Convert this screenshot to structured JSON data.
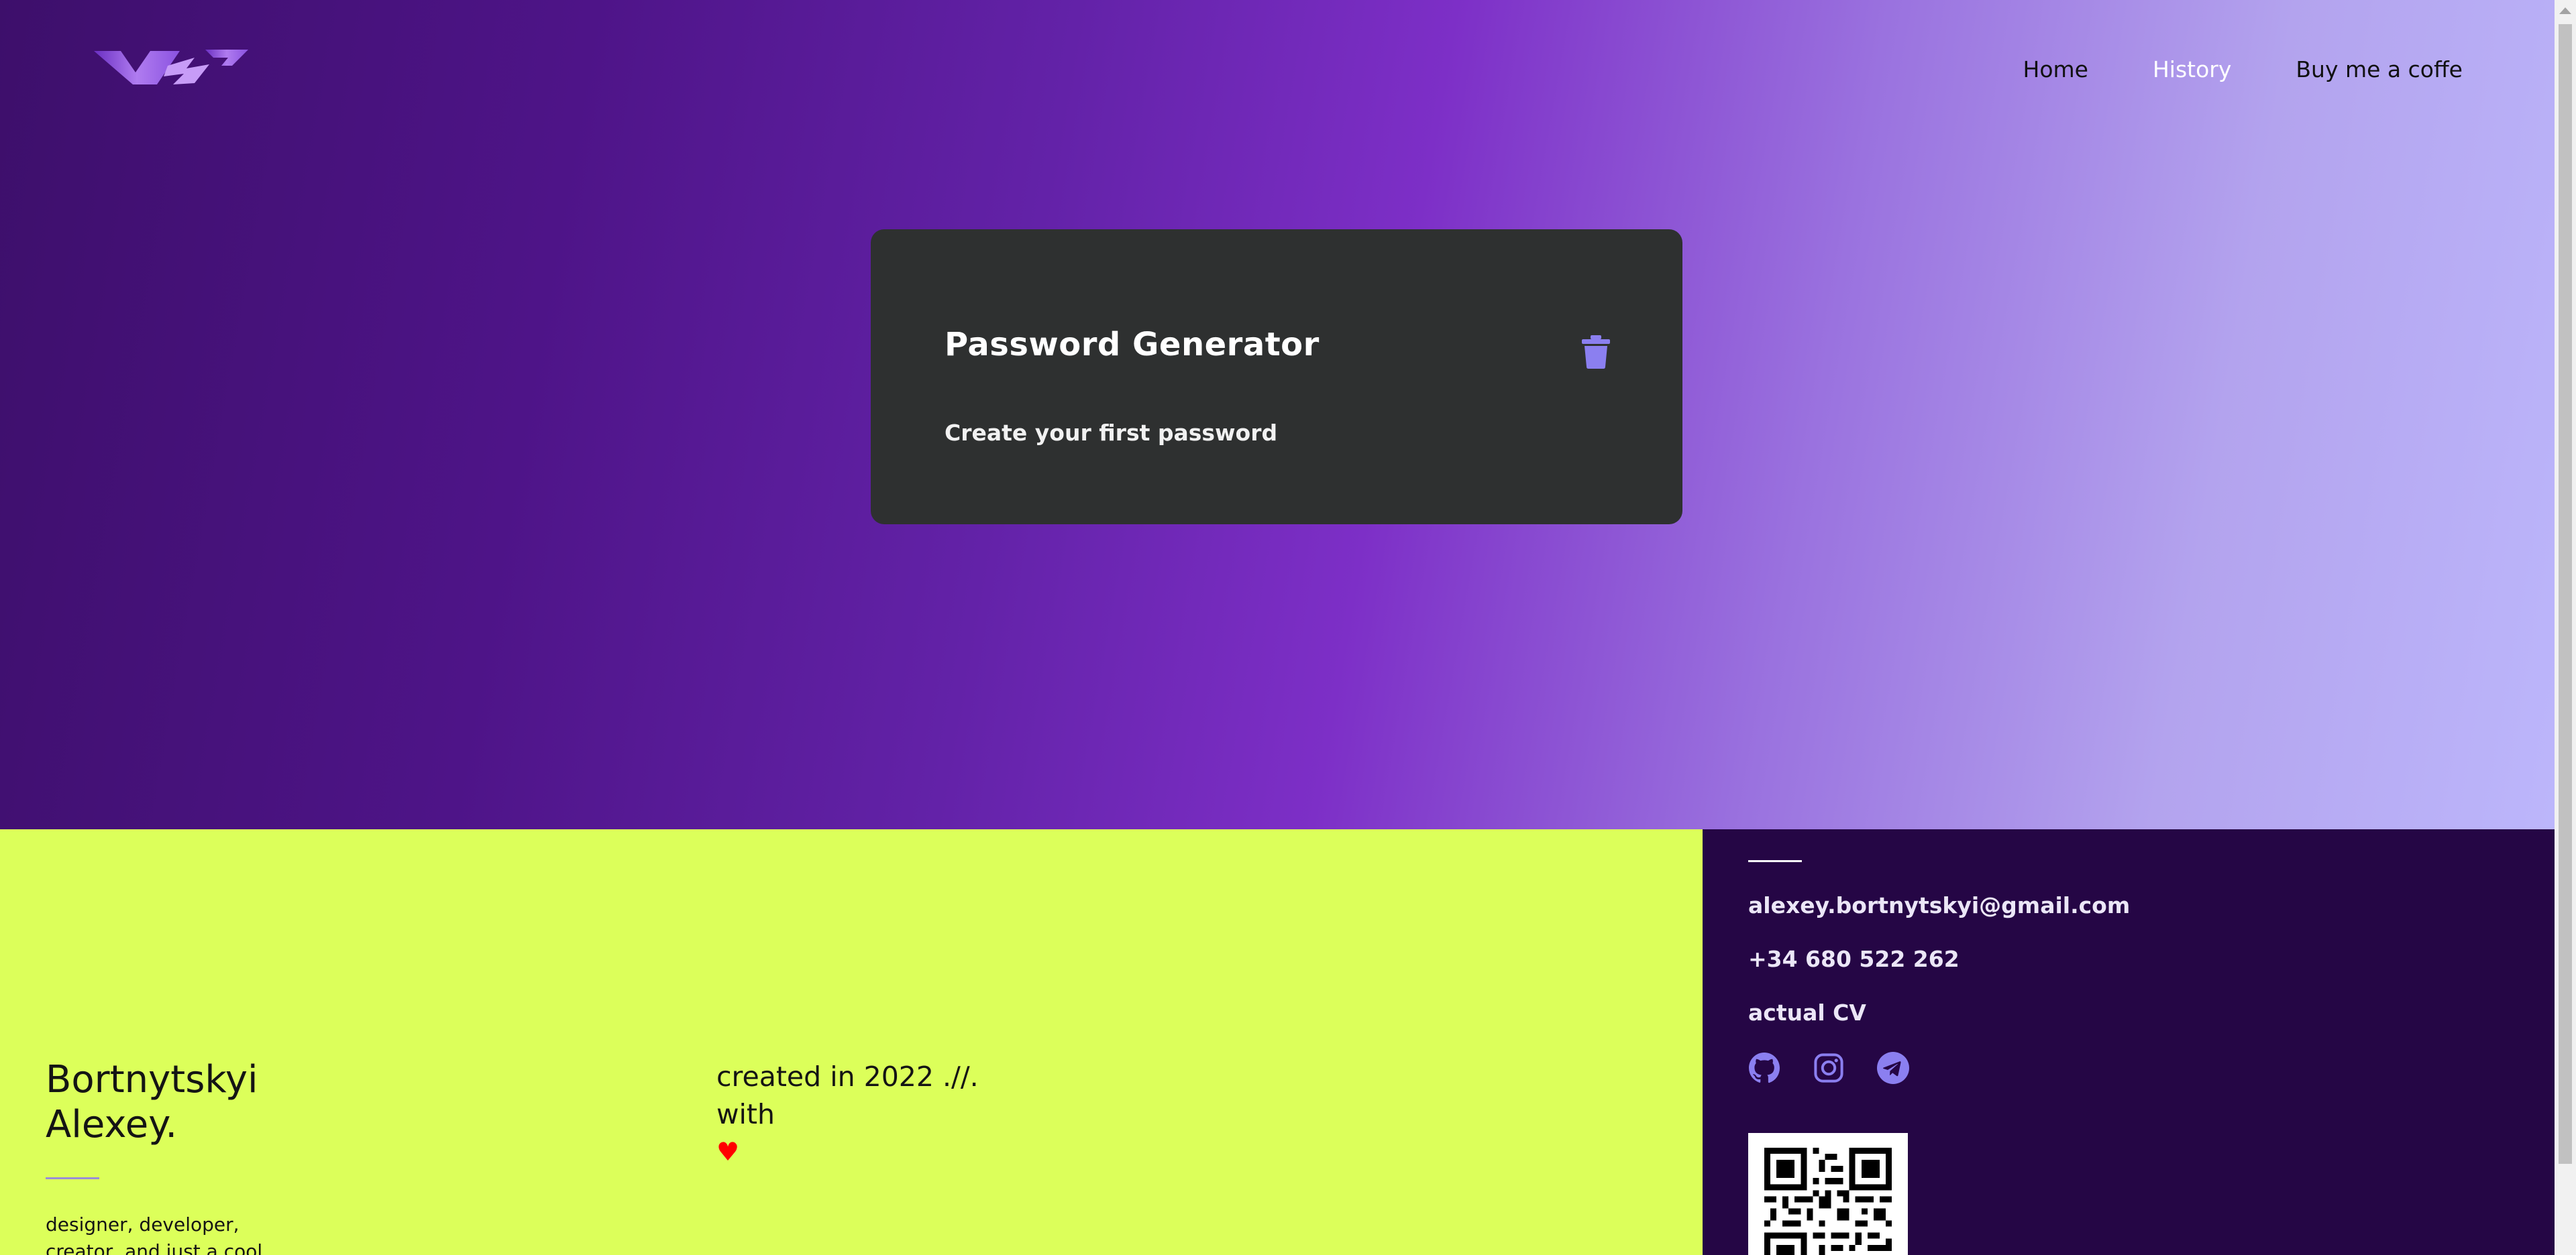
{
  "nav": {
    "items": [
      {
        "label": "Home",
        "active": false
      },
      {
        "label": "History",
        "active": true
      },
      {
        "label": "Buy me a coffe",
        "active": false
      }
    ]
  },
  "card": {
    "title": "Password Generator",
    "subtitle": "Create your first password",
    "action_icon": "trash-icon"
  },
  "footer": {
    "name_line1": "Bortnytskyi",
    "name_line2": "Alexey.",
    "bio": "designer, developer, creator, and just a cool",
    "created_line1": "created in 2022 .//.",
    "created_line2": "with",
    "heart": "♥",
    "email": "alexey.bortnytskyi@gmail.com",
    "phone": "+34 680 522 262",
    "cv": "actual CV",
    "social_icons": [
      "github-icon",
      "instagram-icon",
      "telegram-icon"
    ]
  },
  "colors": {
    "accent": "#8b7ff0",
    "footer_left_bg": "#dcff5a",
    "footer_right_bg": "#250645",
    "card_bg": "#2e3030"
  }
}
